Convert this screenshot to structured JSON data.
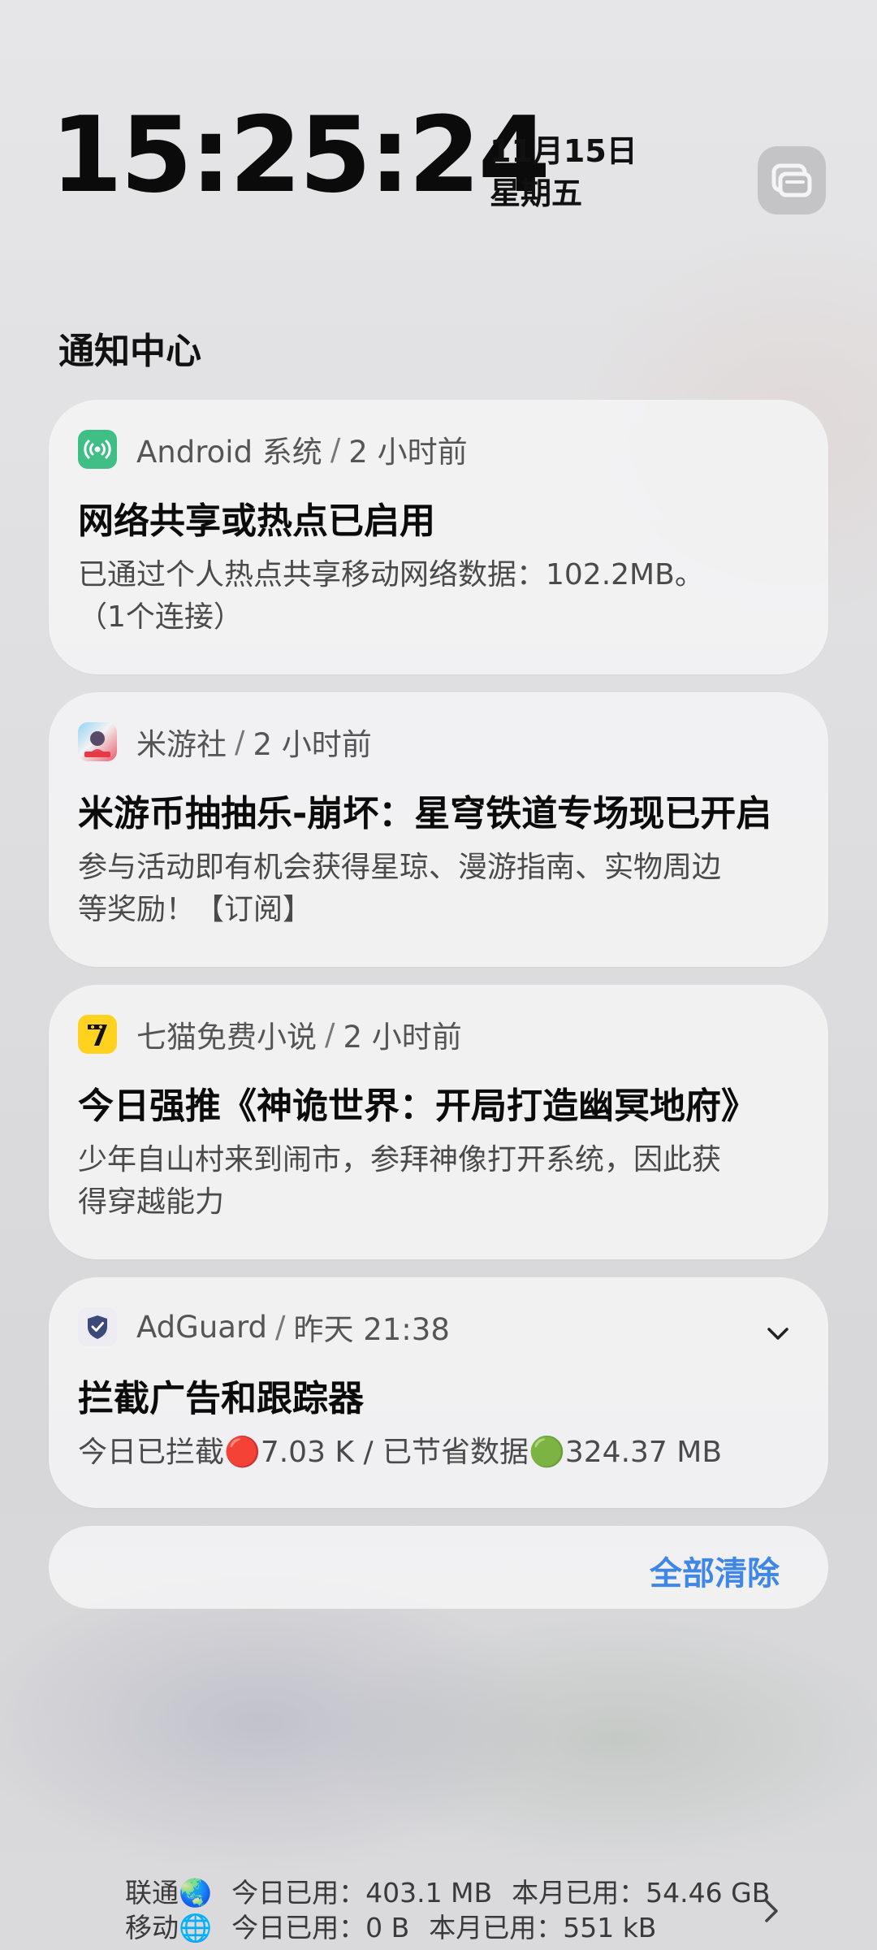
{
  "header": {
    "time": "15:25:24",
    "date": "11月15日",
    "weekday": "星期五",
    "edit_icon": "manage-icon"
  },
  "notification_center": {
    "title": "通知中心",
    "clear_all": "全部清除"
  },
  "notifications": [
    {
      "app": "Android 系统",
      "time": "2 小时前",
      "icon": "hotspot-icon",
      "icon_color": "#3fbf86",
      "title": "网络共享或热点已启用",
      "body_line1": "已通过个人热点共享移动网络数据：102.2MB。",
      "body_line2": "（1个连接）"
    },
    {
      "app": "米游社",
      "time": "2 小时前",
      "icon": "miyoushe-app-icon",
      "title": "米游币抽抽乐-崩坏：星穹铁道专场现已开启",
      "body_line1": "参与活动即有机会获得星琼、漫游指南、实物周边",
      "body_line2": "等奖励！【订阅】"
    },
    {
      "app": "七猫免费小说",
      "time": "2 小时前",
      "icon": "qimao-app-icon",
      "icon_color": "#ffd21f",
      "title": "今日强推《神诡世界：开局打造幽冥地府》",
      "body_line1": "少年自山村来到闹市，参拜神像打开系统，因此获",
      "body_line2": "得穿越能力"
    },
    {
      "app": "AdGuard",
      "time": "昨天 21:38",
      "icon": "adguard-shield-icon",
      "title": "拦截广告和跟踪器",
      "body_line1": "今日已拦截🔴7.03 K / 已节省数据🟢324.37 MB",
      "expand_icon": "chevron-down-icon"
    }
  ],
  "footer": {
    "row1": {
      "carrier": "联通🌏",
      "today": "今日已用：403.1 MB",
      "month": "本月已用：54.46 GB"
    },
    "row2": {
      "carrier": "移动🌐",
      "today": "今日已用：0 B",
      "month": "本月已用：551 kB"
    }
  }
}
